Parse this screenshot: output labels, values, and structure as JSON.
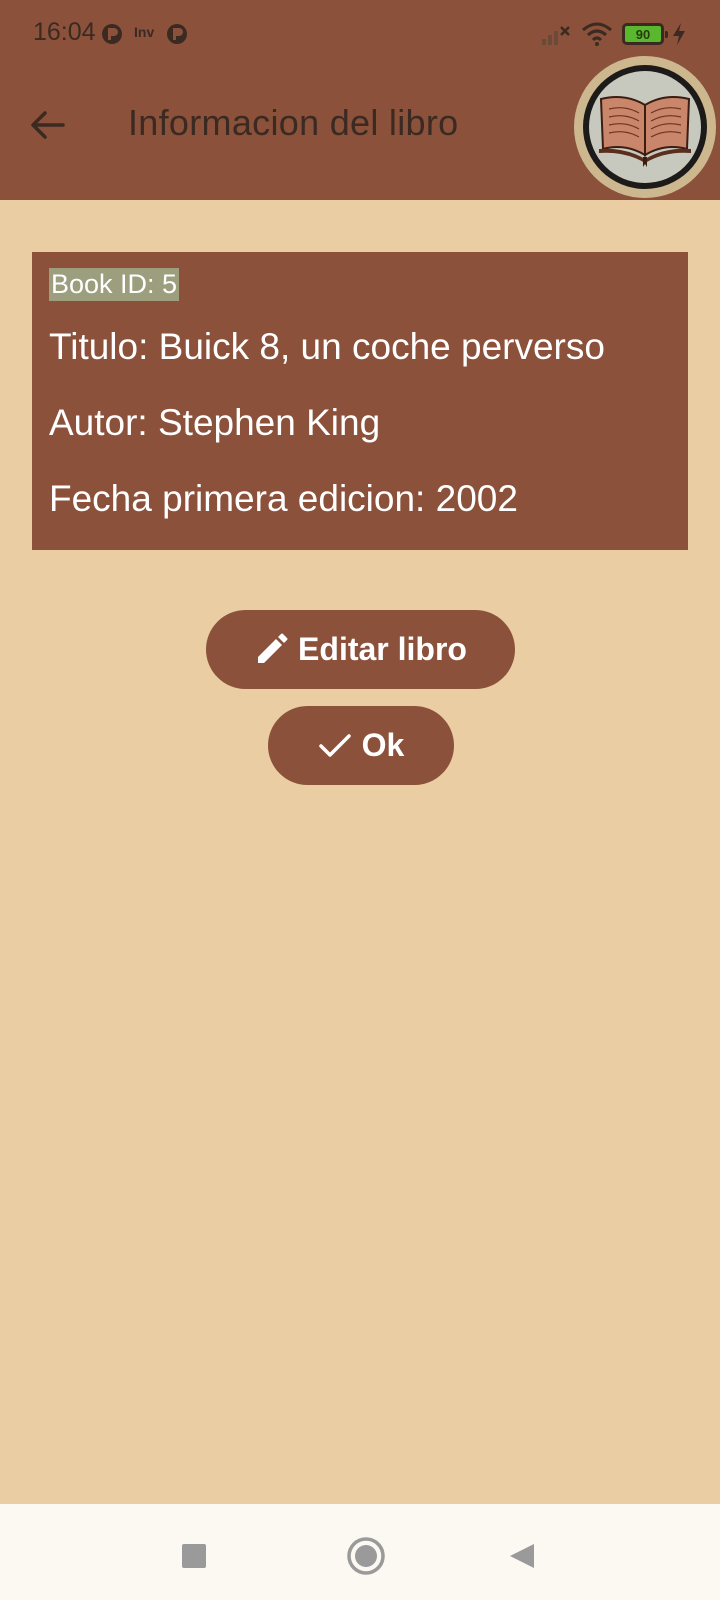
{
  "status_bar": {
    "time": "16:04",
    "small_label": "Inv",
    "battery_level": "90"
  },
  "app_bar": {
    "title": "Informacion del libro",
    "back_icon": "arrow-left-icon",
    "logo": "open-book-logo"
  },
  "book": {
    "id_line": "Book ID: 5",
    "title_line": "Titulo: Buick 8, un coche perverso",
    "author_line": "Autor: Stephen King",
    "date_line": "Fecha primera edicion: 2002"
  },
  "actions": {
    "edit_label": "Editar libro",
    "edit_icon": "pencil-icon",
    "ok_label": "Ok",
    "ok_icon": "check-icon"
  },
  "nav_bar": {
    "recents_icon": "square-icon",
    "home_icon": "circle-icon",
    "back_icon": "triangle-back-icon"
  },
  "colors": {
    "primary": "#8B513B",
    "background": "#EACDA3",
    "id_highlight": "#9C9E7E"
  }
}
